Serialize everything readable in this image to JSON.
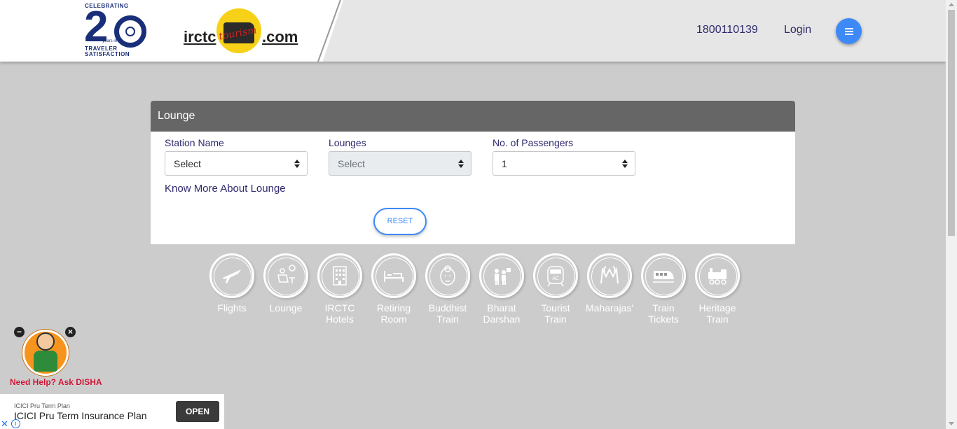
{
  "header": {
    "anniversary_logo": {
      "top_text": "CELEBRATING",
      "number": "2",
      "years_text": "years in",
      "bottom_text": "TRAVELER SATISFACTION"
    },
    "brand_logo": {
      "left_text": "irctc",
      "script_text": "tourism",
      "right_text": ".com"
    },
    "phone": "1800110139",
    "login_label": "Login"
  },
  "panel": {
    "title": "Lounge",
    "fields": [
      {
        "label": "Station Name",
        "value": "Select",
        "disabled": false
      },
      {
        "label": "Lounges",
        "value": "Select",
        "disabled": true
      },
      {
        "label": "No. of Passengers",
        "value": "1",
        "disabled": false
      }
    ],
    "know_more": "Know More About Lounge",
    "reset_label": "RESET"
  },
  "services": [
    {
      "label": "Flights",
      "icon": "airplane-icon"
    },
    {
      "label": "Lounge",
      "icon": "lounge-icon"
    },
    {
      "label": "IRCTC\nHotels",
      "icon": "hotel-icon"
    },
    {
      "label": "Retiring\nRoom",
      "icon": "bed-icon"
    },
    {
      "label": "Buddhist\nTrain",
      "icon": "buddha-icon"
    },
    {
      "label": "Bharat\nDarshan",
      "icon": "tourist-group-icon"
    },
    {
      "label": "Tourist\nTrain",
      "icon": "ac-train-icon"
    },
    {
      "label": "Maharajas'",
      "icon": "maharajas-logo-icon"
    },
    {
      "label": "Train\nTickets",
      "icon": "train-icon"
    },
    {
      "label": "Heritage\nTrain",
      "icon": "steam-engine-icon"
    }
  ],
  "disha": {
    "text": "Need Help? Ask DISHA"
  },
  "ad": {
    "small_text": "ICICI Pru Term Plan",
    "title": "ICICI Pru Term Insurance Plan",
    "button": "OPEN"
  },
  "colors": {
    "accent": "#3d8af7",
    "nav_text": "#2e2a6e",
    "panel_header": "#666666",
    "background": "#cccccc"
  }
}
